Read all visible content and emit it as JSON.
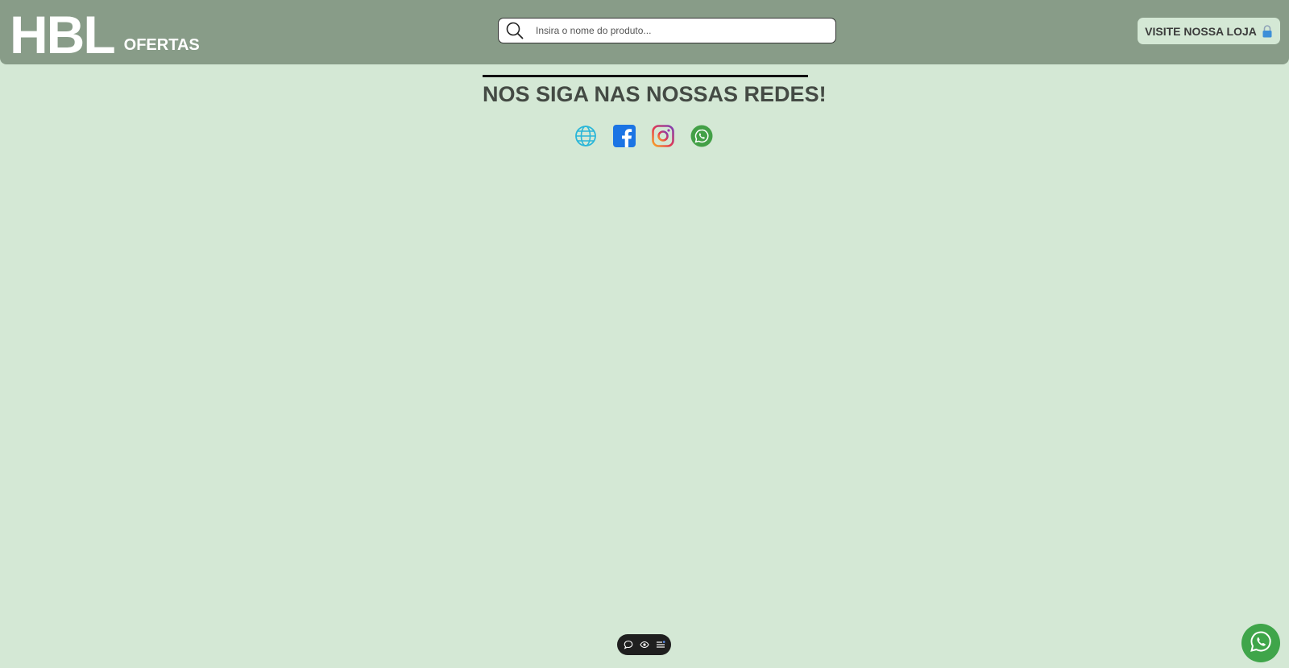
{
  "header": {
    "logo_main": "HBL",
    "logo_sub": "OFERTAS",
    "search_placeholder": "Insira o nome do produto...",
    "search_icon": "search-icon",
    "store_button_label": "VISITE NOSSA LOJA",
    "store_button_icon": "lock-icon"
  },
  "main": {
    "title": "NOS SIGA NAS NOSSAS REDES!",
    "social_links": [
      {
        "icon": "globe-icon",
        "color": "#29b6d9"
      },
      {
        "icon": "facebook-icon",
        "color": "#1b74e4"
      },
      {
        "icon": "instagram-icon",
        "color": "#c13584"
      },
      {
        "icon": "whatsapp-icon",
        "color": "#43a047"
      }
    ]
  },
  "toolbar": {
    "items": [
      "comment-icon",
      "eye-icon",
      "list-icon"
    ]
  },
  "floating": {
    "whatsapp_icon": "whatsapp-icon",
    "color": "#3fa54a"
  },
  "colors": {
    "header_bg": "#889c88",
    "page_bg": "#d4e8d5",
    "title_text": "#444a44"
  }
}
